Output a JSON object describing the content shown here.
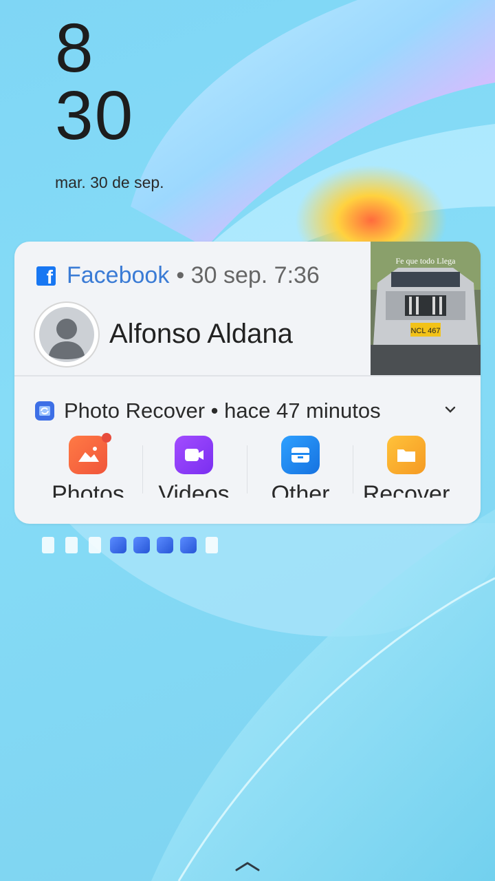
{
  "lockscreen": {
    "hour": "8",
    "minute": "30",
    "date": "mar. 30 de sep."
  },
  "notifications": {
    "facebook": {
      "app_name": "Facebook",
      "meta": "• 30 sep. 7:36",
      "sender": "Alfonso Aldana",
      "thumbnail_caption": "Fe que todo Llega",
      "plate": "NCL 467"
    },
    "photo_recover": {
      "title": "Photo Recover • hace 47 minutos",
      "actions": [
        {
          "label": "Photos",
          "icon": "photos-icon",
          "color": "#f0553a",
          "badge": true
        },
        {
          "label": "Videos",
          "icon": "videos-icon",
          "color": "#8e3cf2",
          "badge": false
        },
        {
          "label": "Other",
          "icon": "other-files-icon",
          "color": "#1e88f0",
          "badge": false
        },
        {
          "label": "Recover",
          "icon": "recover-folder-icon",
          "color": "#f5a623",
          "badge": false
        }
      ]
    }
  },
  "colors": {
    "facebook_blue": "#1877f2",
    "card_bg": "#f2f4f7",
    "wallpaper": "#7fd6f5"
  }
}
